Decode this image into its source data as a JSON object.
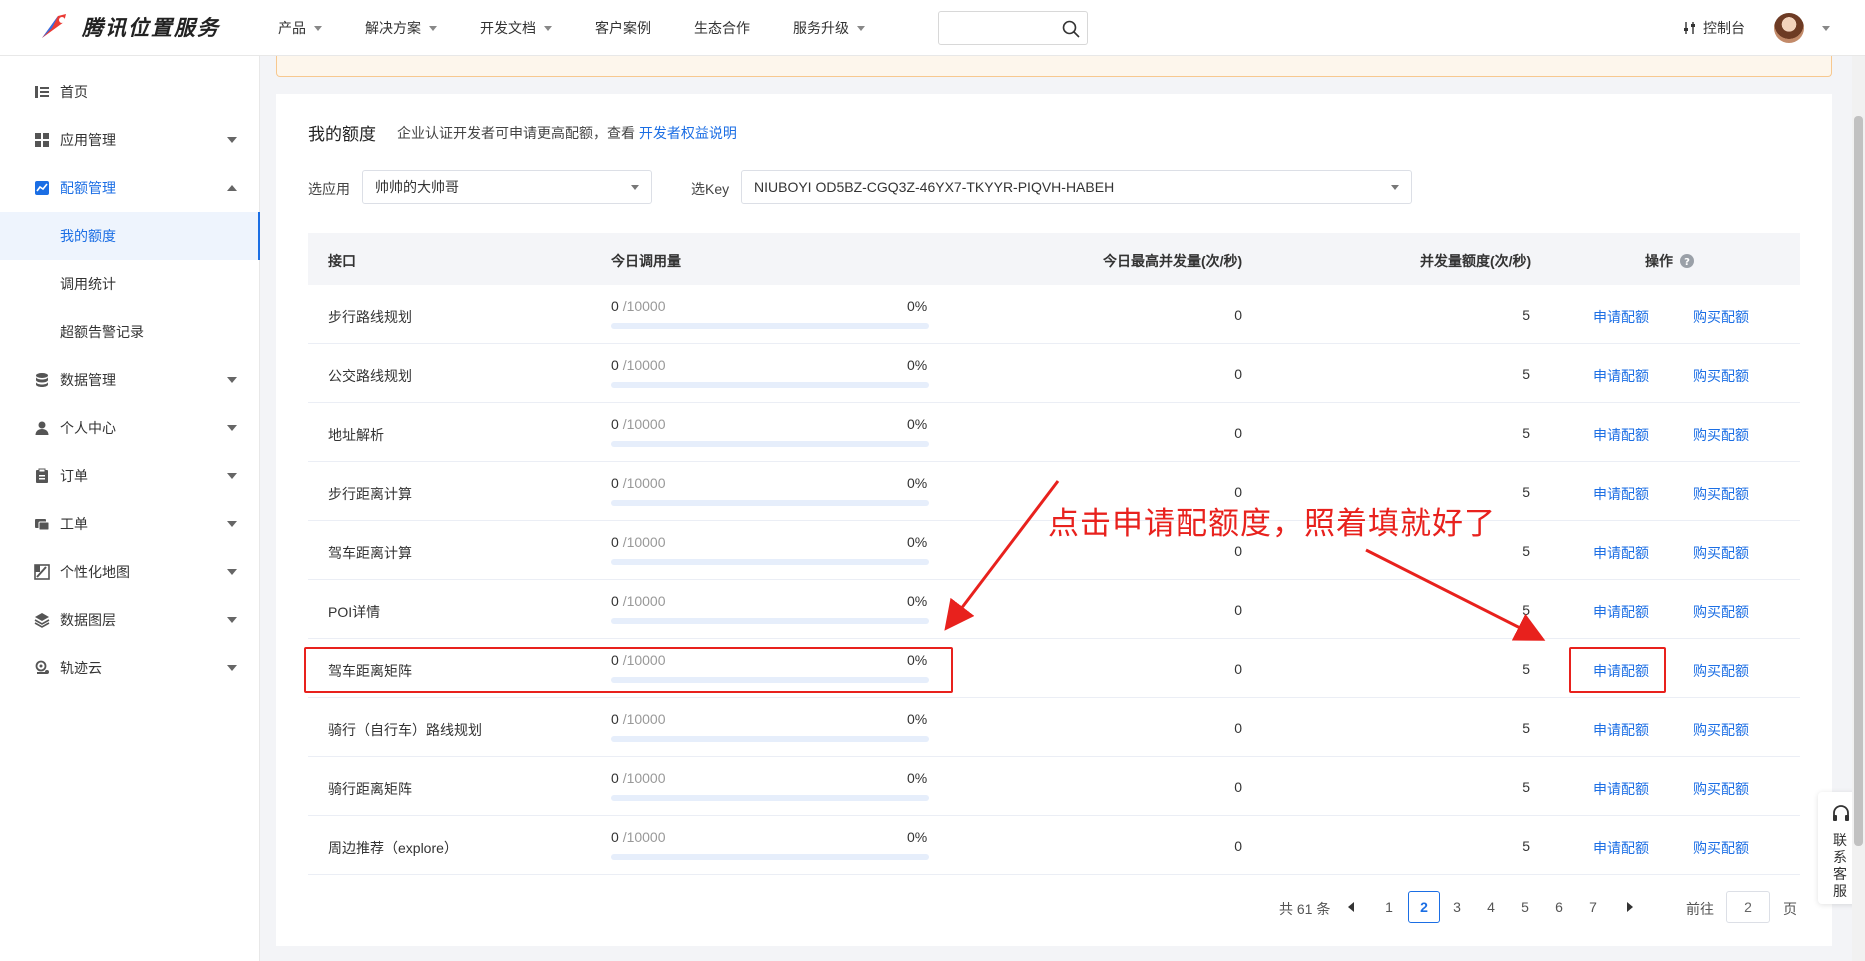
{
  "brand": {
    "name": "腾讯位置服务"
  },
  "nav": [
    {
      "label": "产品",
      "dropdown": true
    },
    {
      "label": "解决方案",
      "dropdown": true
    },
    {
      "label": "开发文档",
      "dropdown": true
    },
    {
      "label": "客户案例",
      "dropdown": false
    },
    {
      "label": "生态合作",
      "dropdown": false
    },
    {
      "label": "服务升级",
      "dropdown": true
    }
  ],
  "header": {
    "console_label": "控制台",
    "search_placeholder": ""
  },
  "sidebar": {
    "items": [
      {
        "label": "首页",
        "icon": "list-icon"
      },
      {
        "label": "应用管理",
        "icon": "grid-icon"
      },
      {
        "label": "配额管理",
        "icon": "chart-icon"
      },
      {
        "label": "我的额度"
      },
      {
        "label": "调用统计"
      },
      {
        "label": "超额告警记录"
      },
      {
        "label": "数据管理",
        "icon": "database-icon"
      },
      {
        "label": "个人中心",
        "icon": "user-icon"
      },
      {
        "label": "订单",
        "icon": "clipboard-icon"
      },
      {
        "label": "工单",
        "icon": "ticket-icon"
      },
      {
        "label": "个性化地图",
        "icon": "map-style-icon"
      },
      {
        "label": "数据图层",
        "icon": "layers-icon"
      },
      {
        "label": "轨迹云",
        "icon": "track-icon"
      }
    ]
  },
  "page": {
    "title": "我的额度",
    "subtitle": "企业认证开发者可申请更高配额，查看",
    "subtitle_link": "开发者权益说明",
    "app_label": "选应用",
    "app_value": "帅帅的大帅哥",
    "key_label": "选Key",
    "key_value": "NIUBOYI OD5BZ-CGQ3Z-46YX7-TKYYR-PIQVH-HABEH"
  },
  "table": {
    "headers": {
      "api": "接口",
      "usage": "今日调用量",
      "max_concurrency": "今日最高并发量(次/秒)",
      "quota": "并发量额度(次/秒)",
      "ops": "操作"
    },
    "apply_label": "申请配额",
    "buy_label": "购买配额",
    "rows": [
      {
        "api": "步行路线规划",
        "used": "0",
        "total": "/10000",
        "pct": "0%",
        "max": "0",
        "quota": "5"
      },
      {
        "api": "公交路线规划",
        "used": "0",
        "total": "/10000",
        "pct": "0%",
        "max": "0",
        "quota": "5"
      },
      {
        "api": "地址解析",
        "used": "0",
        "total": "/10000",
        "pct": "0%",
        "max": "0",
        "quota": "5"
      },
      {
        "api": "步行距离计算",
        "used": "0",
        "total": "/10000",
        "pct": "0%",
        "max": "0",
        "quota": "5"
      },
      {
        "api": "驾车距离计算",
        "used": "0",
        "total": "/10000",
        "pct": "0%",
        "max": "0",
        "quota": "5"
      },
      {
        "api": "POI详情",
        "used": "0",
        "total": "/10000",
        "pct": "0%",
        "max": "0",
        "quota": "5"
      },
      {
        "api": "驾车距离矩阵",
        "used": "0",
        "total": "/10000",
        "pct": "0%",
        "max": "0",
        "quota": "5"
      },
      {
        "api": "骑行（自行车）路线规划",
        "used": "0",
        "total": "/10000",
        "pct": "0%",
        "max": "0",
        "quota": "5"
      },
      {
        "api": "骑行距离矩阵",
        "used": "0",
        "total": "/10000",
        "pct": "0%",
        "max": "0",
        "quota": "5"
      },
      {
        "api": "周边推荐（explore）",
        "used": "0",
        "total": "/10000",
        "pct": "0%",
        "max": "0",
        "quota": "5"
      }
    ]
  },
  "pagination": {
    "total": "共 61 条",
    "pages": [
      "1",
      "2",
      "3",
      "4",
      "5",
      "6",
      "7"
    ],
    "current": "2",
    "goto_label": "前往",
    "goto_value": "2",
    "page_unit": "页"
  },
  "annotation": {
    "text": "点击申请配额度，照着填就好了",
    "color": "#e8211d"
  },
  "service": {
    "label": "联系客服"
  },
  "colors": {
    "accent": "#1b6ee4",
    "annotation": "#e8211d"
  }
}
